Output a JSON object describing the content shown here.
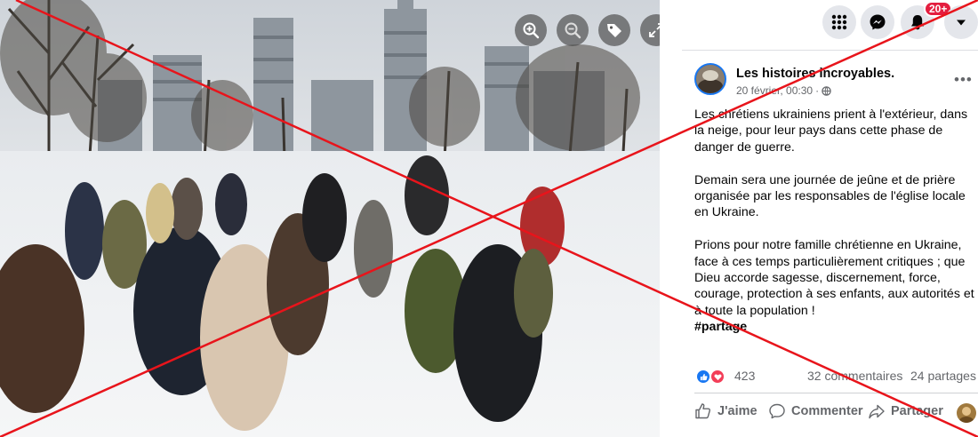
{
  "viewer": {
    "zoom_in_icon": "zoom-in-icon",
    "zoom_out_icon": "zoom-out-icon",
    "tag_icon": "tag-icon",
    "fullscreen_icon": "fullscreen-icon"
  },
  "topbar": {
    "menu_icon": "grid-menu-icon",
    "messenger_icon": "messenger-icon",
    "notifications_icon": "bell-icon",
    "notifications_badge": "20+",
    "account_icon": "caret-down-icon"
  },
  "post": {
    "author": "Les histoires incroyables.",
    "date": "20 février, 00:30",
    "separator": "·",
    "audience_icon": "globe-icon",
    "more_label": "•••",
    "paragraphs": [
      "Les chrétiens ukrainiens prient à l'extérieur, dans la neige, pour leur pays dans cette phase de danger de guerre.",
      "Demain sera une journée de jeûne et de prière organisée par les responsables de l'église locale en Ukraine.",
      "Prions pour notre famille chrétienne en Ukraine, face à ces temps particulièrement critiques ; que Dieu accorde sagesse, discernement, force, courage, protection à ses enfants, aux autorités et à toute la population !"
    ],
    "hashtag": "#partage"
  },
  "stats": {
    "reactions_count": "423",
    "comments": "32 commentaires",
    "shares": "24 partages"
  },
  "actions": {
    "like": "J'aime",
    "comment": "Commenter",
    "share": "Partager"
  },
  "colors": {
    "facebook_blue": "#1877f2",
    "love_red": "#f33e58",
    "badge_red": "#e41e3f",
    "overlay_cross": "#e8141b"
  }
}
